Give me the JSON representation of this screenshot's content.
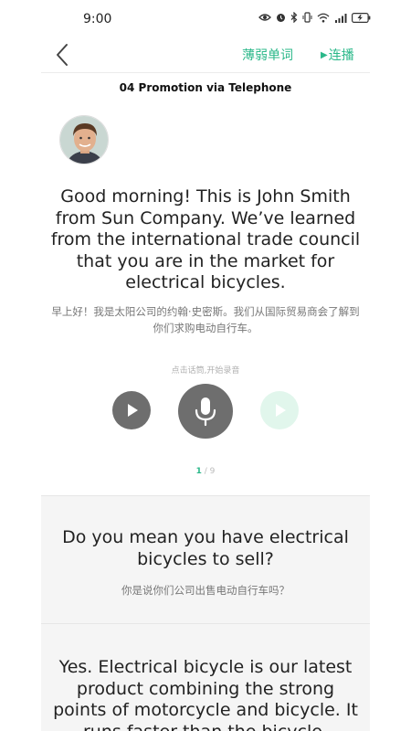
{
  "status_bar": {
    "time": "9:00",
    "icons": [
      "eye-icon",
      "alarm-icon",
      "bluetooth-icon",
      "vibrate-icon",
      "wifi-icon",
      "signal-icon",
      "battery-icon"
    ]
  },
  "nav": {
    "back_icon": "chevron-left-icon",
    "weak_words_label": "薄弱单词",
    "autoplay_icon": "play-triangle-icon",
    "autoplay_label": "连播"
  },
  "lesson": {
    "title": "04 Promotion via Telephone"
  },
  "current_sentence": {
    "speaker_avatar": "avatar-man",
    "en": "Good morning! This is John Smith from Sun Company. We’ve learned from the international trade council that you are in the market for electrical bicycles.",
    "zh": "早上好！我是太阳公司的约翰·史密斯。我们从国际贸易商会了解到你们求购电动自行车。"
  },
  "recorder": {
    "hint": "点击话筒,开始录音",
    "play_icon": "play-icon",
    "mic_icon": "microphone-icon",
    "replay_icon": "play-recording-icon"
  },
  "pager": {
    "current": "1",
    "separator": "/",
    "total": "9"
  },
  "next_sentences": [
    {
      "en": "Do you mean you have electrical bicycles to sell?",
      "zh": "你是说你们公司出售电动自行车吗？"
    },
    {
      "en": "Yes. Electrical bicycle is our latest product combining the strong points of motorcycle and bicycle. It runs faster than the bicycle, powered"
    }
  ],
  "colors": {
    "accent": "#2bb88a",
    "button_gray": "#6e6e6e",
    "disabled_play": "#e1f6ec",
    "card_bg": "#f5f5f5"
  }
}
